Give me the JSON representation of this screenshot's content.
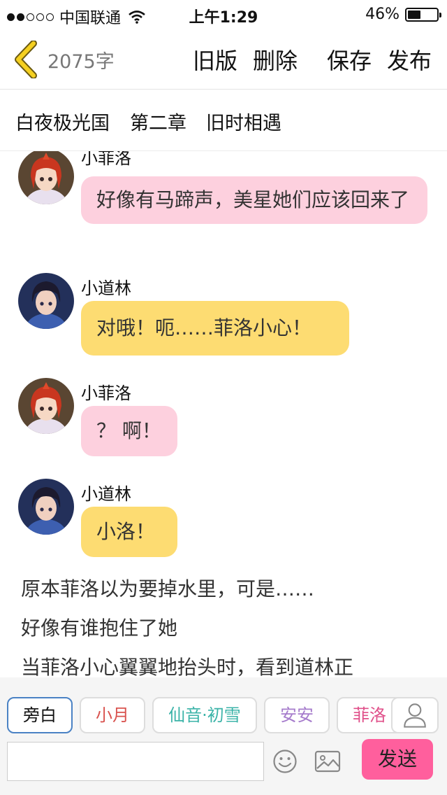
{
  "status_bar": {
    "carrier": "中国联通",
    "time": "上午1:29",
    "battery_text": "46%",
    "battery_level": 0.46
  },
  "toolbar": {
    "word_count": "2075字",
    "old_version_label": "旧版",
    "delete_label": "删除",
    "save_label": "保存",
    "publish_label": "发布"
  },
  "chapter": {
    "book": "白夜极光国",
    "number": "第二章",
    "title": "旧时相遇"
  },
  "messages": [
    {
      "sender": "小菲洛",
      "text": "好像有马蹄声，美星她们应该回来了",
      "bubble_color": "#fdd0de",
      "avatar": "feiluo-avatar"
    },
    {
      "sender": "小道林",
      "text": "对哦！呃……菲洛小心！",
      "bubble_color": "#fddc72",
      "avatar": "daolin-avatar"
    },
    {
      "sender": "小菲洛",
      "text": "？ 啊！",
      "bubble_color": "#fdd0de",
      "avatar": "feiluo-avatar"
    },
    {
      "sender": "小道林",
      "text": "小洛！",
      "bubble_color": "#fddc72",
      "avatar": "daolin-avatar"
    }
  ],
  "narration": [
    "原本菲洛以为要掉水里，可是……",
    "好像有谁抱住了她",
    "当菲洛小心翼翼地抬头时，看到道林正"
  ],
  "roles": [
    {
      "label": "旁白",
      "color": "#111111",
      "active": true
    },
    {
      "label": "小月",
      "color": "#d9534f",
      "active": false
    },
    {
      "label": "仙音·初雪",
      "color": "#3bb3a8",
      "active": false
    },
    {
      "label": "安安",
      "color": "#a67ccc",
      "active": false
    },
    {
      "label": "菲洛",
      "color": "#e0508a",
      "active": false
    }
  ],
  "input": {
    "value": "",
    "send_label": "发送"
  },
  "icons": {
    "back": "chevron-left-icon",
    "role_user": "user-icon",
    "emoji": "smiley-icon",
    "image": "image-icon"
  },
  "colors": {
    "back_chevron": "#f5d020",
    "send_button": "#ff5f9d",
    "active_role_border": "#4a82c4"
  }
}
